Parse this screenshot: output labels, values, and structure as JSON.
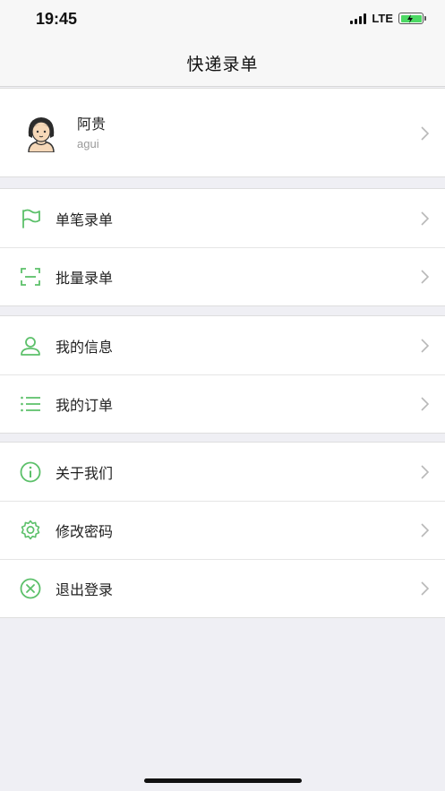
{
  "status_bar": {
    "time": "19:45",
    "network": "LTE",
    "battery_icon": "battery-charging-icon",
    "signal_icon": "signal-icon"
  },
  "nav": {
    "title": "快递录单"
  },
  "profile": {
    "name": "阿贵",
    "username": "agui",
    "avatar_icon": "avatar-girl-icon"
  },
  "groups": [
    {
      "items": [
        {
          "label": "单笔录单",
          "icon": "flag-icon"
        },
        {
          "label": "批量录单",
          "icon": "scan-icon"
        }
      ]
    },
    {
      "items": [
        {
          "label": "我的信息",
          "icon": "user-icon"
        },
        {
          "label": "我的订单",
          "icon": "list-icon"
        }
      ]
    },
    {
      "items": [
        {
          "label": "关于我们",
          "icon": "info-icon"
        },
        {
          "label": "修改密码",
          "icon": "gear-icon"
        },
        {
          "label": "退出登录",
          "icon": "close-circle-icon"
        }
      ]
    }
  ],
  "colors": {
    "accent": "#5cc06a",
    "background": "#efeff4",
    "chevron": "#b8b8b8"
  }
}
